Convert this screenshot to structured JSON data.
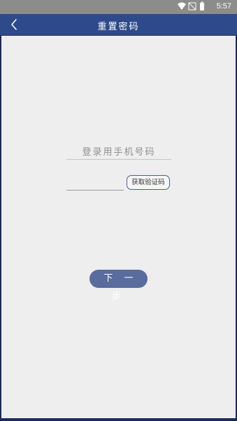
{
  "status_bar": {
    "time": "5:57",
    "icons": [
      "wifi-icon",
      "no-signal-icon",
      "battery-icon"
    ]
  },
  "header": {
    "title": "重置密码",
    "back_icon": "chevron-left-icon"
  },
  "form": {
    "phone_placeholder": "登录用手机号码",
    "phone_value": "",
    "code_placeholder": "",
    "code_value": "",
    "get_code_label": "获取验证码",
    "next_label": "下 一 步"
  },
  "colors": {
    "status_bar": "#8c8c8c",
    "title_bar": "#2e4a8a",
    "background": "#eeeeee",
    "button_primary": "#5a6b9e",
    "button_border": "#4a5a9a"
  }
}
